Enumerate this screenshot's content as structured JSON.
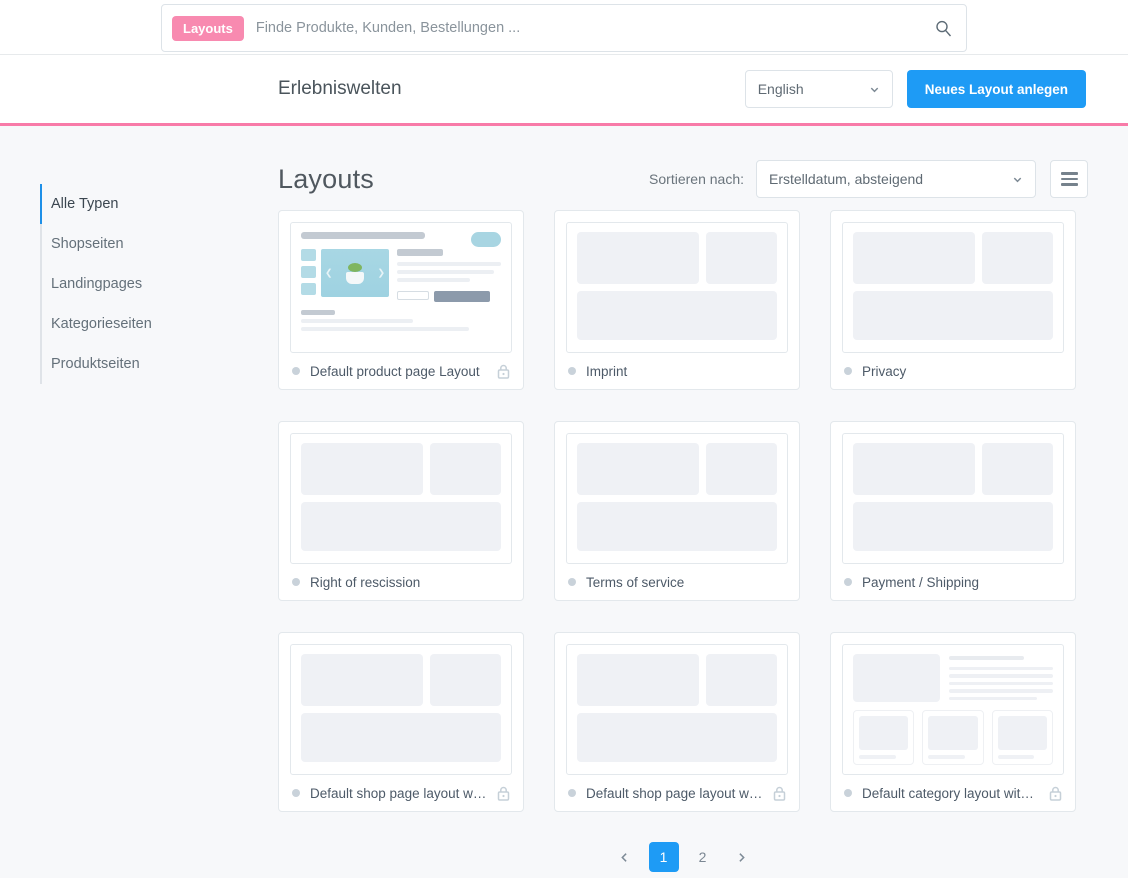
{
  "search": {
    "badge": "Layouts",
    "placeholder": "Finde Produkte, Kunden, Bestellungen ...",
    "value": "",
    "icon": "search-icon"
  },
  "header": {
    "title": "Erlebniswelten",
    "language": "English",
    "create_button": "Neues Layout anlegen",
    "accent_color": "#1e9bf5",
    "divider_color": "#f87ba8"
  },
  "sidebar": {
    "items": [
      {
        "label": "Alle Typen",
        "active": true
      },
      {
        "label": "Shopseiten",
        "active": false
      },
      {
        "label": "Landingpages",
        "active": false
      },
      {
        "label": "Kategorieseiten",
        "active": false
      },
      {
        "label": "Produktseiten",
        "active": false
      }
    ]
  },
  "main": {
    "title": "Layouts",
    "sort_label": "Sortieren nach:",
    "sort_value": "Erstelldatum, absteigend",
    "view_toggle_icon": "list-view-icon"
  },
  "cards": [
    {
      "title": "Default product page Layout",
      "locked": true,
      "thumb": "product-page"
    },
    {
      "title": "Imprint",
      "locked": false,
      "thumb": "wireframe"
    },
    {
      "title": "Privacy",
      "locked": false,
      "thumb": "wireframe"
    },
    {
      "title": "Right of rescission",
      "locked": false,
      "thumb": "wireframe"
    },
    {
      "title": "Terms of service",
      "locked": false,
      "thumb": "wireframe"
    },
    {
      "title": "Payment / Shipping",
      "locked": false,
      "thumb": "wireframe"
    },
    {
      "title": "Default shop page layout wi…",
      "locked": true,
      "thumb": "wireframe"
    },
    {
      "title": "Default shop page layout wi…",
      "locked": true,
      "thumb": "wireframe"
    },
    {
      "title": "Default category layout with…",
      "locked": true,
      "thumb": "category"
    }
  ],
  "pagination": {
    "prev_icon": "chevron-left-icon",
    "next_icon": "chevron-right-icon",
    "pages": [
      "1",
      "2"
    ],
    "current": "1"
  }
}
